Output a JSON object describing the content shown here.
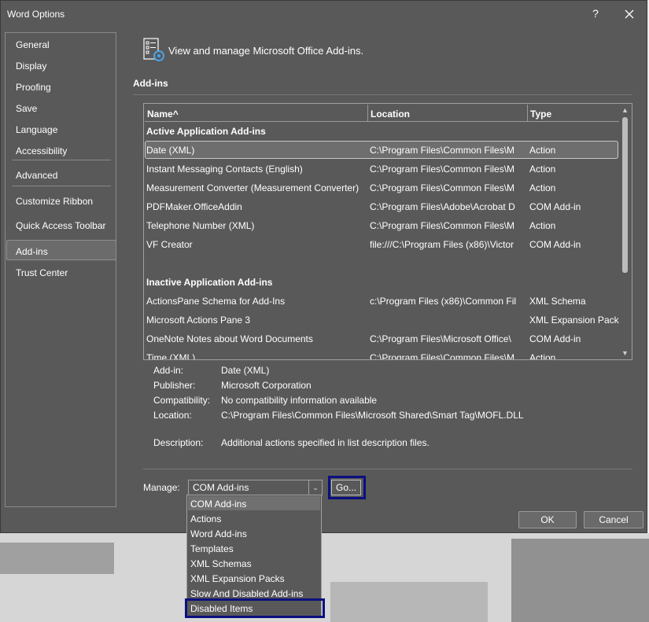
{
  "window": {
    "title": "Word Options",
    "help": "?"
  },
  "sidebar": {
    "items": [
      "General",
      "Display",
      "Proofing",
      "Save",
      "Language",
      "Accessibility",
      "Advanced",
      "Customize Ribbon",
      "Quick Access Toolbar",
      "Add-ins",
      "Trust Center"
    ],
    "selected": "Add-ins"
  },
  "header": {
    "text": "View and manage Microsoft Office Add-ins."
  },
  "section": {
    "title": "Add-ins"
  },
  "table": {
    "columns": [
      "Name",
      "Location",
      "Type"
    ],
    "sort_indicator": "^",
    "groups": [
      {
        "title": "Active Application Add-ins",
        "rows": [
          [
            "Date (XML)",
            "C:\\Program Files\\Common Files\\M",
            "Action"
          ],
          [
            "Instant Messaging Contacts (English)",
            "C:\\Program Files\\Common Files\\M",
            "Action"
          ],
          [
            "Measurement Converter (Measurement Converter)",
            "C:\\Program Files\\Common Files\\M",
            "Action"
          ],
          [
            "PDFMaker.OfficeAddin",
            "C:\\Program Files\\Adobe\\Acrobat D",
            "COM Add-in"
          ],
          [
            "Telephone Number (XML)",
            "C:\\Program Files\\Common Files\\M",
            "Action"
          ],
          [
            "VF Creator",
            "file:///C:\\Program Files (x86)\\Victor",
            "COM Add-in"
          ]
        ]
      },
      {
        "title": "Inactive Application Add-ins",
        "rows": [
          [
            "ActionsPane Schema for Add-Ins",
            "c:\\Program Files (x86)\\Common Fil",
            "XML Schema"
          ],
          [
            "Microsoft Actions Pane 3",
            "",
            "XML Expansion Pack"
          ],
          [
            "OneNote Notes about Word Documents",
            "C:\\Program Files\\Microsoft Office\\",
            "COM Add-in"
          ],
          [
            "Time (XML)",
            "C:\\Program Files\\Common Files\\M",
            "Action"
          ]
        ]
      }
    ]
  },
  "details": {
    "addin_label": "Add-in:",
    "addin": "Date (XML)",
    "publisher_label": "Publisher:",
    "publisher": "Microsoft Corporation",
    "compat_label": "Compatibility:",
    "compat": "No compatibility information available",
    "location_label": "Location:",
    "location": "C:\\Program Files\\Common Files\\Microsoft Shared\\Smart Tag\\MOFL.DLL",
    "description_label": "Description:",
    "description": "Additional actions specified in list description files."
  },
  "manage": {
    "label": "Manage:",
    "value": "COM Add-ins",
    "go_label": "Go...",
    "options": [
      "COM Add-ins",
      "Actions",
      "Word Add-ins",
      "Templates",
      "XML Schemas",
      "XML Expansion Packs",
      "Slow And Disabled Add-ins",
      "Disabled Items"
    ]
  },
  "buttons": {
    "ok": "OK",
    "cancel": "Cancel"
  },
  "colors": {
    "dialog_bg": "#595959",
    "highlight_border": "#0b0f80",
    "text": "#ffffff"
  }
}
